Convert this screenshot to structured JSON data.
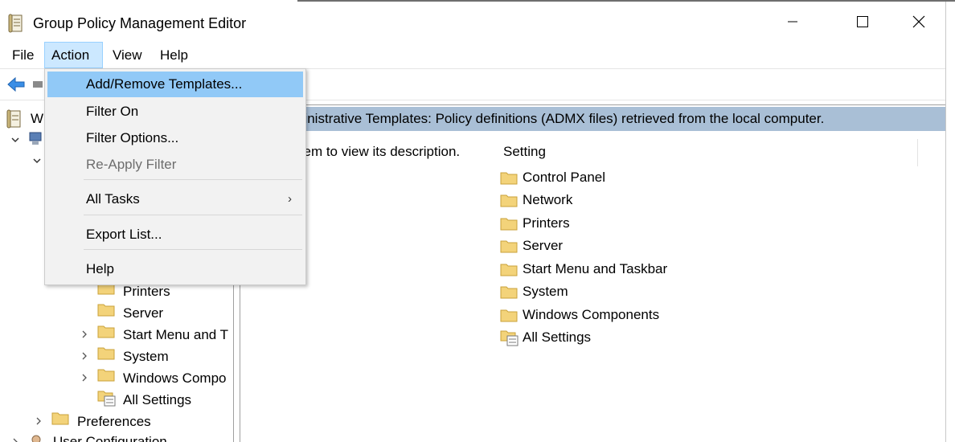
{
  "window": {
    "title": "Group Policy Management Editor",
    "icons": [
      "gpo-editor-icon",
      "minimize-icon",
      "maximize-icon",
      "close-icon"
    ]
  },
  "menu_bar": {
    "file": "File",
    "action": "Action",
    "view": "View",
    "help": "Help",
    "active_item": "Action"
  },
  "action_menu": {
    "add_remove_templates": "Add/Remove Templates...",
    "filter_on": "Filter On",
    "filter_options": "Filter Options...",
    "reapply_filter": "Re-Apply Filter",
    "all_tasks": "All Tasks",
    "all_tasks_arrow": "›",
    "export_list": "Export List...",
    "help": "Help"
  },
  "tree": {
    "root_partial": "W",
    "printers": "Printers",
    "server": "Server",
    "start_menu": "Start Menu and T",
    "system": "System",
    "windows_components": "Windows Compo",
    "all_settings": "All Settings",
    "preferences": "Preferences",
    "user_configuration": "User Configuration"
  },
  "details": {
    "header": "ninistrative Templates: Policy definitions (ADMX files) retrieved from the local computer.",
    "description": "item to view its description.",
    "column_setting": "Setting",
    "items": [
      "Control Panel",
      "Network",
      "Printers",
      "Server",
      "Start Menu and Taskbar",
      "System",
      "Windows Components",
      "All Settings"
    ]
  },
  "colors": {
    "menu_highlight": "#91c9f7",
    "menu_active": "#cce8ff",
    "header_band": "#a9bfd6",
    "folder": "#f3d37a"
  }
}
